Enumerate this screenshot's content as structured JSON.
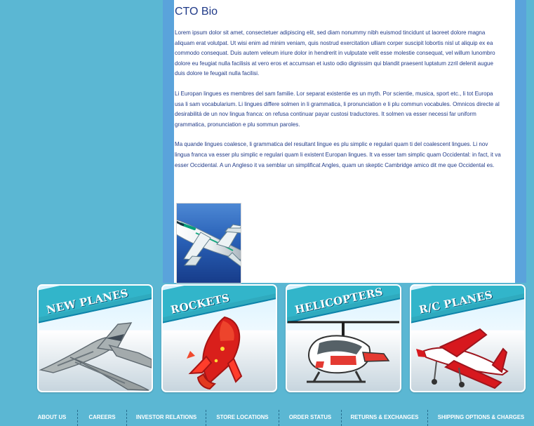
{
  "article": {
    "title": "CTO Bio",
    "paragraphs": [
      "Lorem ipsum dolor sit amet, consectetuer adipiscing elit, sed diam nonummy nibh euismod tincidunt ut laoreet dolore magna aliquam erat volutpat. Ut wisi enim ad minim veniam, quis nostrud exercitation ulliam corper suscipit lobortis nisl ut aliquip ex ea commodo consequat. Duis autem veleum iriure dolor in hendrerit in vulputate velit esse molestie consequat, vel willum lunombro dolore eu feugiat nulla facilisis at vero eros et accumsan et iusto odio dignissim qui blandit praesent luptatum zzril delenit augue duis dolore te feugait nulla facilisi.",
      "Li Europan lingues es membres del sam familie. Lor separat existentie es un myth. Por scientie, musica, sport etc., li tot Europa usa li sam vocabularium. Li lingues differe solmen in li grammatica, li pronunciation e li plu commun vocabules. Omnicos directe al desirabilitá de un nov lingua franca: on refusa continuar payar custosi traductores. It solmen va esser necessi far uniform grammatica, pronunciation e plu sommun paroles.",
      "Ma quande lingues coalesce, li grammatica del resultant lingue es plu simplic e regulari quam ti del coalescent lingues. Li nov lingua franca va esser plu simplic e regulari quam li existent Europan lingues. It va esser tam simplic quam Occidental: in fact, it va esser Occidental. A un Angleso it va semblar un simplificat Angles, quam un skeptic Cambridge amico dit me que Occidental es."
    ],
    "image_icon": "airliner-photo-icon"
  },
  "feature_cards": [
    {
      "label": "NEW PLANES",
      "icon": "fighter-jet-icon"
    },
    {
      "label": "ROCKETS",
      "icon": "rocket-icon"
    },
    {
      "label": "HELICOPTERS",
      "icon": "helicopter-icon"
    },
    {
      "label": "R/C PLANES",
      "icon": "rc-plane-icon"
    }
  ],
  "footer_links": [
    "ABOUT US",
    "CAREERS",
    "INVESTOR RELATIONS",
    "STORE LOCATIONS",
    "ORDER STATUS",
    "RETURNS & EXCHANGES",
    "SHIPPING OPTIONS & CHARGES"
  ],
  "colors": {
    "background": "#5bb7d3",
    "content_frame": "#5aa3db",
    "text": "#203a88",
    "banner": "#32b5ca",
    "footer_text": "#ffffff"
  }
}
